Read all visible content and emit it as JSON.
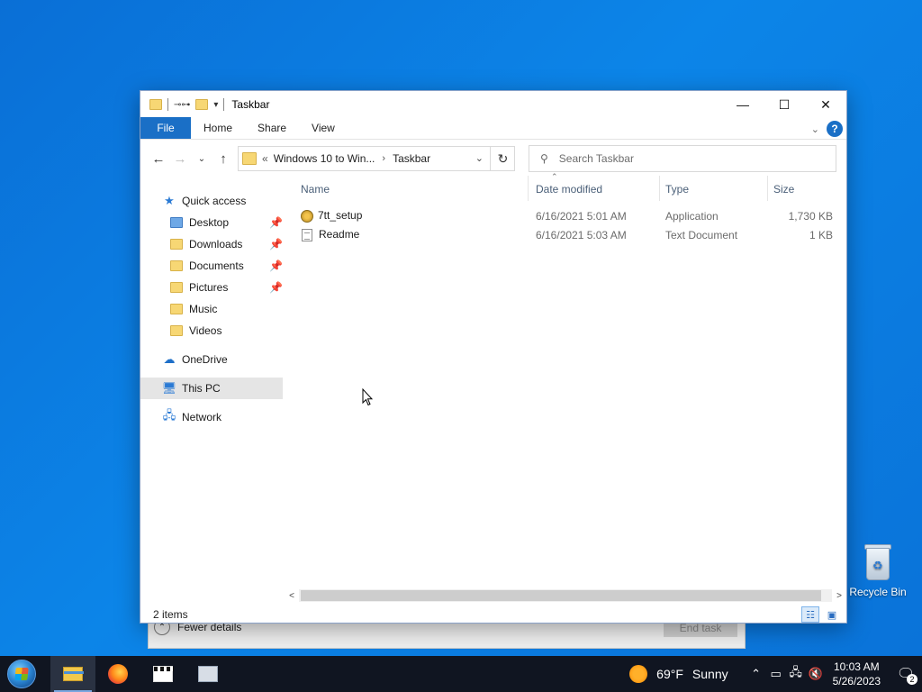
{
  "background_window": {
    "fewer_details_label": "Fewer details",
    "end_task_label": "End task"
  },
  "window": {
    "title": "Taskbar",
    "ribbon_tabs": [
      "File",
      "Home",
      "Share",
      "View"
    ],
    "help_label": "?",
    "address": {
      "overflow": "«",
      "crumbs": [
        "Windows 10 to Win...",
        "Taskbar"
      ]
    },
    "search": {
      "placeholder": "Search Taskbar"
    },
    "sidebar": {
      "quick_access": "Quick access",
      "items": [
        {
          "label": "Desktop",
          "pinned": true
        },
        {
          "label": "Downloads",
          "pinned": true
        },
        {
          "label": "Documents",
          "pinned": true
        },
        {
          "label": "Pictures",
          "pinned": true
        },
        {
          "label": "Music",
          "pinned": false
        },
        {
          "label": "Videos",
          "pinned": false
        }
      ],
      "onedrive": "OneDrive",
      "this_pc": "This PC",
      "network": "Network"
    },
    "columns": {
      "name": "Name",
      "date": "Date modified",
      "type": "Type",
      "size": "Size"
    },
    "files": [
      {
        "name": "7tt_setup",
        "date": "6/16/2021 5:01 AM",
        "type": "Application",
        "size": "1,730 KB"
      },
      {
        "name": "Readme",
        "date": "6/16/2021 5:03 AM",
        "type": "Text Document",
        "size": "1 KB"
      }
    ],
    "status": "2 items"
  },
  "desktop": {
    "recycle_bin_label": "Recycle Bin"
  },
  "taskbar": {
    "weather_temp": "69°F",
    "weather_desc": "Sunny",
    "time": "10:03 AM",
    "date": "5/26/2023",
    "notification_count": "2"
  }
}
